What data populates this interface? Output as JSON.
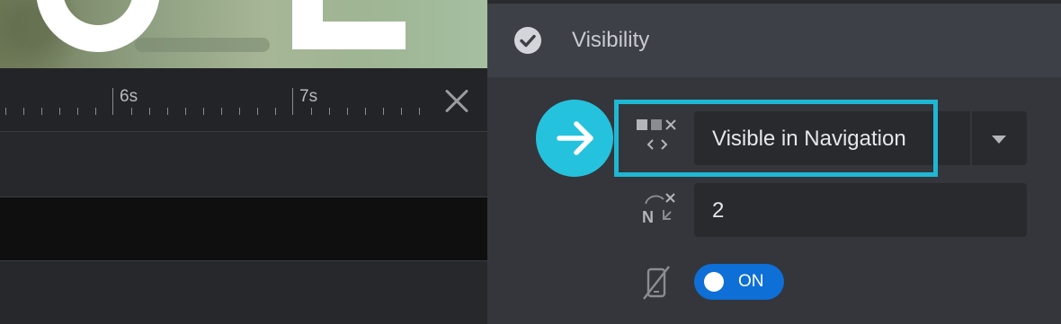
{
  "timeline": {
    "ruler_labels": [
      "6s",
      "7s"
    ],
    "close_icon": "close-icon"
  },
  "panel": {
    "title": "Visibility",
    "title_icon": "check-circle-icon",
    "visibility_select": {
      "value": "Visible in Navigation",
      "icon": "visibility-navigation-icon"
    },
    "slide_number_field": {
      "value": "2",
      "icon": "slide-number-icon"
    },
    "mobile_toggle": {
      "label": "ON",
      "icon": "mobile-hidden-icon",
      "state": true
    },
    "highlight_color": "#1fb7d3",
    "badge_color": "#25c2de",
    "toggle_color": "#0e6fd6"
  }
}
